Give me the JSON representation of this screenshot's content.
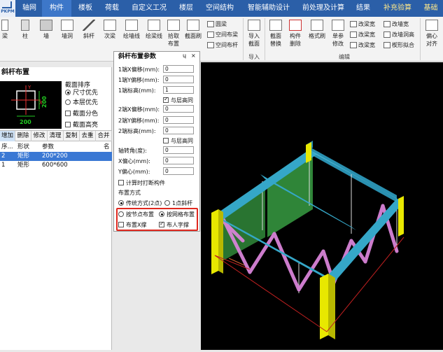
{
  "logo": {
    "text": "PKPM"
  },
  "menu": {
    "tabs": [
      "轴网",
      "构件",
      "楼板",
      "荷载",
      "自定义工况",
      "楼层",
      "空间结构",
      "智能辅助设计",
      "前处理及计算",
      "结果",
      "补充验算",
      "基础"
    ]
  },
  "ribbon": {
    "buttons": {
      "liang": "梁",
      "zhu": "柱",
      "qiang": "墙",
      "qiangdong": "墙洞",
      "xiegan": "斜杆",
      "ciliang": "次梁",
      "huihuixian": "绘墙线",
      "huiliangxian": "绘梁线",
      "shiqu_buzhi_1": "拾取",
      "shiqu_buzhi_2": "布置",
      "jiemianshua": "截面刷",
      "yuanliang": "圆梁",
      "kongjian_buliang": "空间布梁",
      "kongjian_bugan": "空间布杆",
      "daoru_jiemian_1": "导入",
      "daoru_jiemian_2": "截面",
      "jiemian_tihuan_1": "截面",
      "jiemian_tihuan_2": "替换",
      "goujian_shanchu_1": "构件",
      "goujian_shanchu_2": "删除",
      "gesi_gou": "格式刷",
      "shandan_xiugai_1": "单参",
      "shandan_xiugai_2": "修改",
      "gailiangkuan_1": "改梁宽",
      "gailiangkuan_2": "改梁宽",
      "gailiangkuan_3": "改梁宽",
      "gaiqiangkuan": "改墙宽",
      "gaiqiangdongkuan": "改墙洞宽",
      "gaiqiangdonggao": "改墙洞高",
      "lengxingniuhe": "楔形拟合",
      "pianxin_duiqi_1": "偏心",
      "pianxin_duiqi_2": "对齐"
    },
    "groups": {
      "daoru": "导入",
      "bianji": "编辑"
    }
  },
  "left_panel": {
    "title": "斜杆布置",
    "section_preview": {
      "y_label": "Y",
      "x_label": "X",
      "height_dim": "200",
      "width_dim": "200"
    },
    "sort": {
      "label": "截面排序",
      "opt1": "尺寸优先",
      "opt2": "本层优先"
    },
    "checks": {
      "fense": "截面分色",
      "gaoliang": "截面高亮"
    },
    "toolbar": [
      "增加",
      "删除",
      "修改",
      "清理",
      "复制",
      "去重",
      "合并"
    ],
    "table": {
      "headers": [
        "序...",
        "形状",
        "参数",
        "名"
      ],
      "rows": [
        {
          "idx": "2",
          "shape": "矩形",
          "param": "200*200"
        },
        {
          "idx": "1",
          "shape": "矩形",
          "param": "600*600"
        }
      ]
    }
  },
  "dialog": {
    "title": "斜杆布置参数",
    "pin": "ɥ",
    "close": "×",
    "fields": {
      "end1_x_label": "1端X偏移(mm):",
      "end1_x": "0",
      "end1_y_label": "1端Y偏移(mm):",
      "end1_y": "0",
      "end1_h_label": "1端标高(mm):",
      "end1_h": "1",
      "same_floor_1": "与层高同",
      "end2_x_label": "2端X偏移(mm):",
      "end2_x": "0",
      "end2_y_label": "2端Y偏移(mm):",
      "end2_y": "0",
      "end2_h_label": "2端标高(mm):",
      "end2_h": "0",
      "same_floor_2": "与层高同",
      "rot_label": "轴转角(度):",
      "rot": "0",
      "xecc_label": "X偏心(mm):",
      "xecc": "0",
      "yecc_label": "Y偏心(mm):",
      "yecc": "0",
      "calc_break": "计算时打断构件"
    },
    "layout": {
      "label": "布置方式",
      "opt_traditional": "传统方式(2点)",
      "opt_onepoint": "1点斜杆",
      "opt_node": "按节点布置",
      "opt_grid": "按网格布置",
      "chk_x": "布置X撑",
      "chk_ren": "布人字撑"
    }
  },
  "colors": {
    "menu_bg": "#2b5fa8",
    "beam": "#35a7c8",
    "column": "#e8e800",
    "brace": "#d783d7",
    "wall": "#3fb24b",
    "highlight": "#e0281f"
  }
}
